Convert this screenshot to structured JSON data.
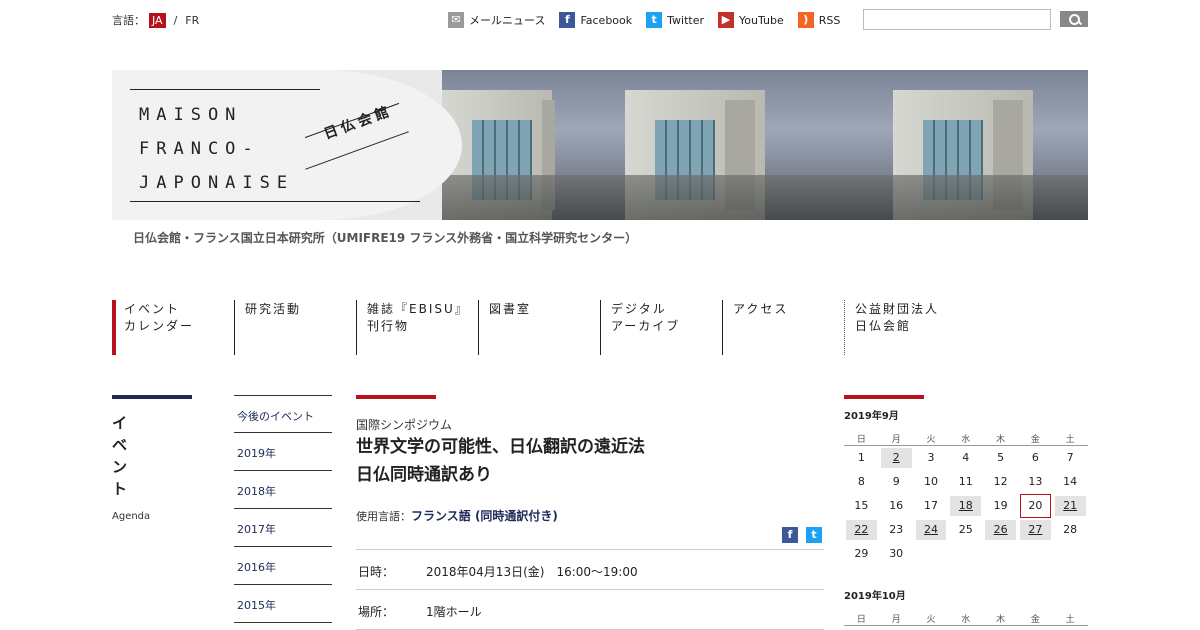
{
  "header": {
    "lang_label": "言語：",
    "lang_ja": "JA",
    "lang_sep": "/",
    "lang_fr": "FR",
    "social": [
      {
        "label": "メールニュース",
        "icon": "mail-icon"
      },
      {
        "label": "Facebook",
        "icon": "facebook-icon"
      },
      {
        "label": "Twitter",
        "icon": "twitter-icon"
      },
      {
        "label": "YouTube",
        "icon": "youtube-icon"
      },
      {
        "label": "RSS",
        "icon": "rss-icon"
      }
    ],
    "search_value": ""
  },
  "banner": {
    "logo_line1": "MAISON",
    "logo_line2": "FRANCO-",
    "logo_line3": "JAPONAISE",
    "logo_ja": "日仏会館"
  },
  "subtitle": "日仏会館・フランス国立日本研究所（UMIFRE19 フランス外務省・国立科学研究センター）",
  "nav": [
    {
      "line1": "イベント",
      "line2": "カレンダー"
    },
    {
      "line1": "研究活動",
      "line2": ""
    },
    {
      "line1": "雑誌『EBISU』",
      "line2": "刊行物"
    },
    {
      "line1": "図書室",
      "line2": ""
    },
    {
      "line1": "デジタル",
      "line2": "アーカイブ"
    },
    {
      "line1": "アクセス",
      "line2": ""
    },
    {
      "line1": "公益財団法人",
      "line2": "日仏会館"
    }
  ],
  "section": {
    "title": "イベント",
    "subtitle": "Agenda"
  },
  "years": [
    "今後のイベント",
    "2019年",
    "2018年",
    "2017年",
    "2016年",
    "2015年"
  ],
  "event": {
    "category": "国際シンポジウム",
    "title_line1": "世界文学の可能性、日仏翻訳の遠近法",
    "title_line2": "日仏同時通訳あり",
    "lang_label": "使用言語：",
    "lang_value": "フランス語 (同時通訳付き)",
    "date_label": "日時：",
    "date_value": "2018年04月13日(金)　16:00〜19:00",
    "place_label": "場所：",
    "place_value": "1階ホール"
  },
  "calendar": {
    "weekdays": [
      "日",
      "月",
      "火",
      "水",
      "木",
      "金",
      "土"
    ],
    "sep_title": "2019年9月",
    "sep_weeks": [
      [
        "1",
        "2",
        "3",
        "4",
        "5",
        "6",
        "7"
      ],
      [
        "8",
        "9",
        "10",
        "11",
        "12",
        "13",
        "14"
      ],
      [
        "15",
        "16",
        "17",
        "18",
        "19",
        "20",
        "21"
      ],
      [
        "22",
        "23",
        "24",
        "25",
        "26",
        "27",
        "28"
      ],
      [
        "29",
        "30",
        "",
        "",
        "",
        "",
        ""
      ]
    ],
    "sep_event_days": [
      "2",
      "18",
      "21",
      "22",
      "24",
      "26",
      "27"
    ],
    "sep_today": "20",
    "oct_title": "2019年10月"
  },
  "colors": {
    "accent_red": "#b5121b",
    "navy": "#1e2a5a"
  }
}
